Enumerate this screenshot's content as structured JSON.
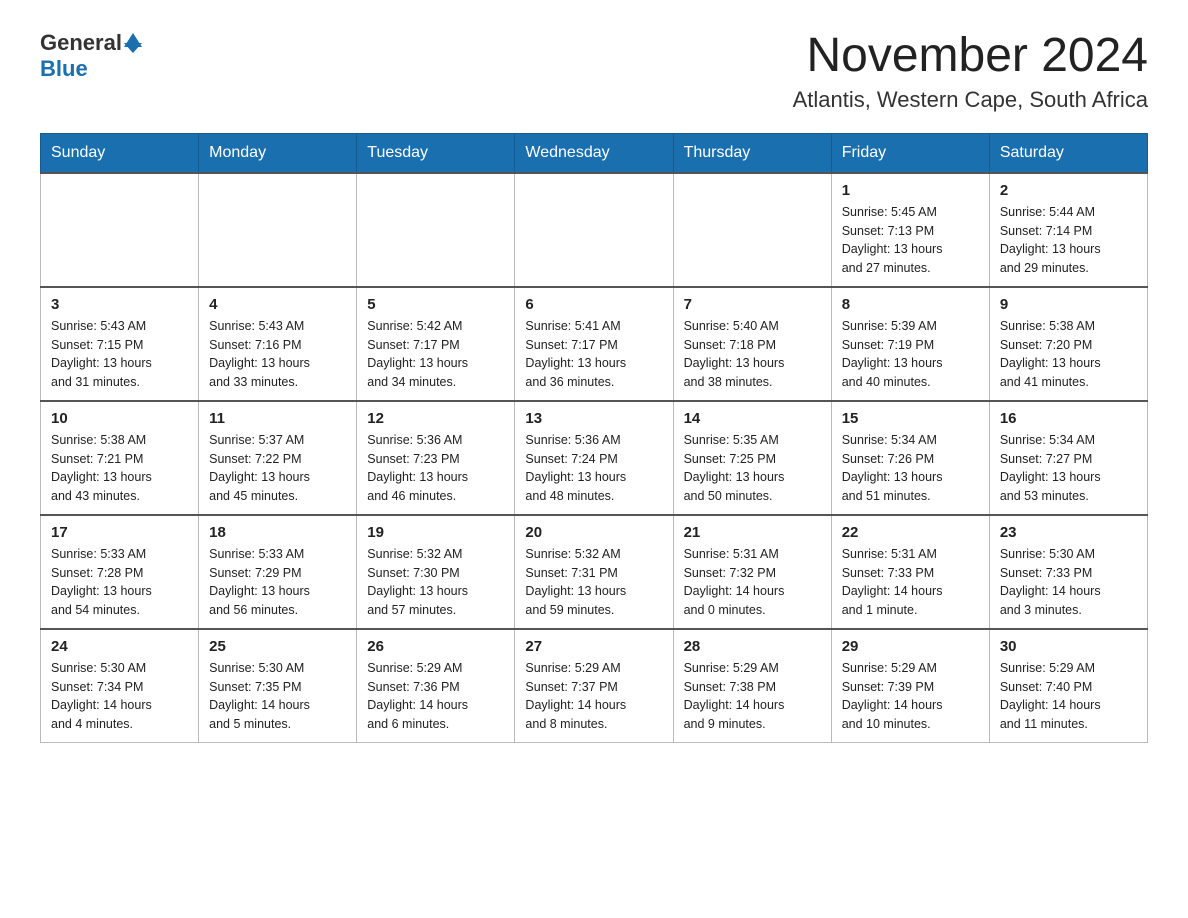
{
  "header": {
    "logo_general": "General",
    "logo_blue": "Blue",
    "month_year": "November 2024",
    "location": "Atlantis, Western Cape, South Africa"
  },
  "weekdays": [
    "Sunday",
    "Monday",
    "Tuesday",
    "Wednesday",
    "Thursday",
    "Friday",
    "Saturday"
  ],
  "weeks": [
    {
      "days": [
        {
          "number": "",
          "info": "",
          "empty": true
        },
        {
          "number": "",
          "info": "",
          "empty": true
        },
        {
          "number": "",
          "info": "",
          "empty": true
        },
        {
          "number": "",
          "info": "",
          "empty": true
        },
        {
          "number": "",
          "info": "",
          "empty": true
        },
        {
          "number": "1",
          "info": "Sunrise: 5:45 AM\nSunset: 7:13 PM\nDaylight: 13 hours\nand 27 minutes."
        },
        {
          "number": "2",
          "info": "Sunrise: 5:44 AM\nSunset: 7:14 PM\nDaylight: 13 hours\nand 29 minutes."
        }
      ]
    },
    {
      "days": [
        {
          "number": "3",
          "info": "Sunrise: 5:43 AM\nSunset: 7:15 PM\nDaylight: 13 hours\nand 31 minutes."
        },
        {
          "number": "4",
          "info": "Sunrise: 5:43 AM\nSunset: 7:16 PM\nDaylight: 13 hours\nand 33 minutes."
        },
        {
          "number": "5",
          "info": "Sunrise: 5:42 AM\nSunset: 7:17 PM\nDaylight: 13 hours\nand 34 minutes."
        },
        {
          "number": "6",
          "info": "Sunrise: 5:41 AM\nSunset: 7:17 PM\nDaylight: 13 hours\nand 36 minutes."
        },
        {
          "number": "7",
          "info": "Sunrise: 5:40 AM\nSunset: 7:18 PM\nDaylight: 13 hours\nand 38 minutes."
        },
        {
          "number": "8",
          "info": "Sunrise: 5:39 AM\nSunset: 7:19 PM\nDaylight: 13 hours\nand 40 minutes."
        },
        {
          "number": "9",
          "info": "Sunrise: 5:38 AM\nSunset: 7:20 PM\nDaylight: 13 hours\nand 41 minutes."
        }
      ]
    },
    {
      "days": [
        {
          "number": "10",
          "info": "Sunrise: 5:38 AM\nSunset: 7:21 PM\nDaylight: 13 hours\nand 43 minutes."
        },
        {
          "number": "11",
          "info": "Sunrise: 5:37 AM\nSunset: 7:22 PM\nDaylight: 13 hours\nand 45 minutes."
        },
        {
          "number": "12",
          "info": "Sunrise: 5:36 AM\nSunset: 7:23 PM\nDaylight: 13 hours\nand 46 minutes."
        },
        {
          "number": "13",
          "info": "Sunrise: 5:36 AM\nSunset: 7:24 PM\nDaylight: 13 hours\nand 48 minutes."
        },
        {
          "number": "14",
          "info": "Sunrise: 5:35 AM\nSunset: 7:25 PM\nDaylight: 13 hours\nand 50 minutes."
        },
        {
          "number": "15",
          "info": "Sunrise: 5:34 AM\nSunset: 7:26 PM\nDaylight: 13 hours\nand 51 minutes."
        },
        {
          "number": "16",
          "info": "Sunrise: 5:34 AM\nSunset: 7:27 PM\nDaylight: 13 hours\nand 53 minutes."
        }
      ]
    },
    {
      "days": [
        {
          "number": "17",
          "info": "Sunrise: 5:33 AM\nSunset: 7:28 PM\nDaylight: 13 hours\nand 54 minutes."
        },
        {
          "number": "18",
          "info": "Sunrise: 5:33 AM\nSunset: 7:29 PM\nDaylight: 13 hours\nand 56 minutes."
        },
        {
          "number": "19",
          "info": "Sunrise: 5:32 AM\nSunset: 7:30 PM\nDaylight: 13 hours\nand 57 minutes."
        },
        {
          "number": "20",
          "info": "Sunrise: 5:32 AM\nSunset: 7:31 PM\nDaylight: 13 hours\nand 59 minutes."
        },
        {
          "number": "21",
          "info": "Sunrise: 5:31 AM\nSunset: 7:32 PM\nDaylight: 14 hours\nand 0 minutes."
        },
        {
          "number": "22",
          "info": "Sunrise: 5:31 AM\nSunset: 7:33 PM\nDaylight: 14 hours\nand 1 minute."
        },
        {
          "number": "23",
          "info": "Sunrise: 5:30 AM\nSunset: 7:33 PM\nDaylight: 14 hours\nand 3 minutes."
        }
      ]
    },
    {
      "days": [
        {
          "number": "24",
          "info": "Sunrise: 5:30 AM\nSunset: 7:34 PM\nDaylight: 14 hours\nand 4 minutes."
        },
        {
          "number": "25",
          "info": "Sunrise: 5:30 AM\nSunset: 7:35 PM\nDaylight: 14 hours\nand 5 minutes."
        },
        {
          "number": "26",
          "info": "Sunrise: 5:29 AM\nSunset: 7:36 PM\nDaylight: 14 hours\nand 6 minutes."
        },
        {
          "number": "27",
          "info": "Sunrise: 5:29 AM\nSunset: 7:37 PM\nDaylight: 14 hours\nand 8 minutes."
        },
        {
          "number": "28",
          "info": "Sunrise: 5:29 AM\nSunset: 7:38 PM\nDaylight: 14 hours\nand 9 minutes."
        },
        {
          "number": "29",
          "info": "Sunrise: 5:29 AM\nSunset: 7:39 PM\nDaylight: 14 hours\nand 10 minutes."
        },
        {
          "number": "30",
          "info": "Sunrise: 5:29 AM\nSunset: 7:40 PM\nDaylight: 14 hours\nand 11 minutes."
        }
      ]
    }
  ]
}
